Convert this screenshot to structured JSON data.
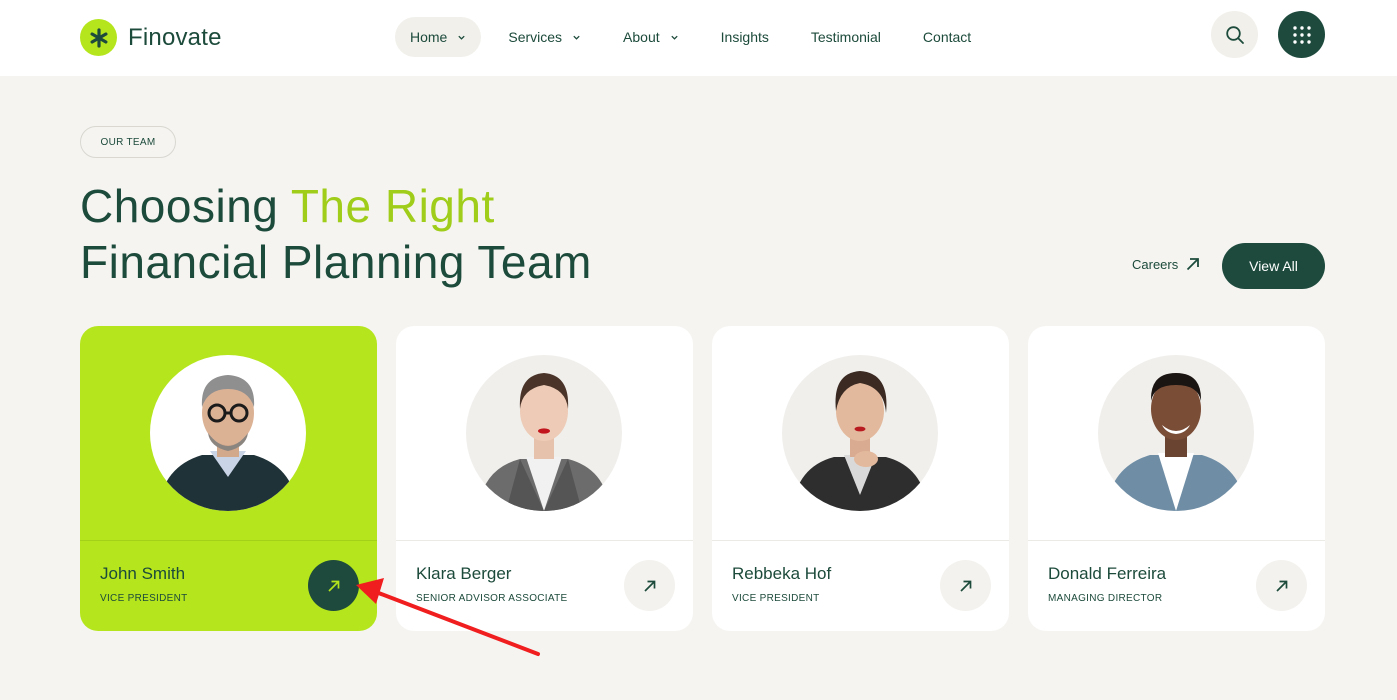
{
  "brand": {
    "name": "Finovate",
    "accent": "#b5e61d",
    "dark": "#1d4a3d"
  },
  "nav": {
    "items": [
      {
        "label": "Home",
        "dropdown": true,
        "active": true
      },
      {
        "label": "Services",
        "dropdown": true
      },
      {
        "label": "About",
        "dropdown": true
      },
      {
        "label": "Insights",
        "dropdown": false
      },
      {
        "label": "Testimonial",
        "dropdown": false
      },
      {
        "label": "Contact",
        "dropdown": false
      }
    ],
    "search_icon": "search-icon",
    "menu_icon": "grid-dots-icon"
  },
  "section": {
    "badge": "OUR TEAM",
    "heading_part1": "Choosing ",
    "heading_accent": "The Right",
    "heading_line2": "Financial Planning Team",
    "careers_label": "Careers",
    "view_all_label": "View All"
  },
  "team": [
    {
      "name": "John Smith",
      "role": "VICE PRESIDENT",
      "highlighted": true
    },
    {
      "name": "Klara Berger",
      "role": "SENIOR ADVISOR ASSOCIATE",
      "highlighted": false
    },
    {
      "name": "Rebbeka Hof",
      "role": "VICE PRESIDENT",
      "highlighted": false
    },
    {
      "name": "Donald Ferreira",
      "role": "MANAGING DIRECTOR",
      "highlighted": false
    }
  ],
  "annotation": {
    "type": "red-arrow",
    "color": "#f01e1e",
    "target": "John Smith arrow button"
  }
}
